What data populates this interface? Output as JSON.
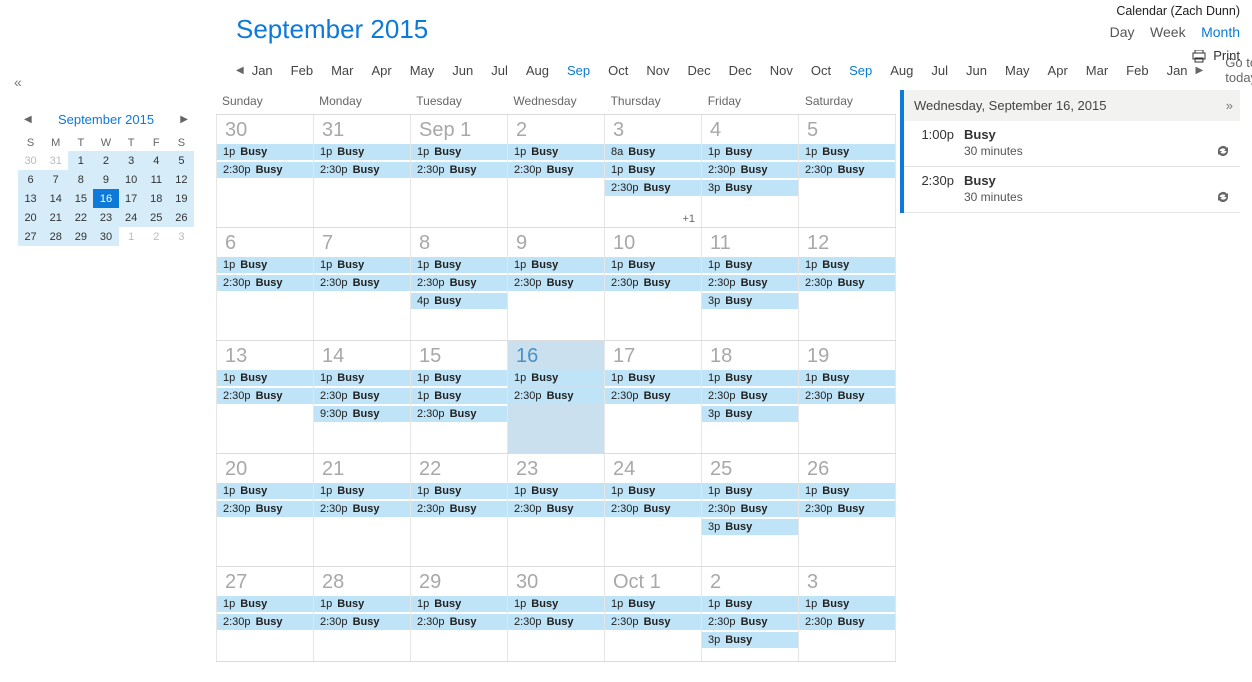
{
  "header": {
    "account_label": "Calendar (Zach Dunn)",
    "views": {
      "day": "Day",
      "week": "Week",
      "month": "Month",
      "active": "month"
    },
    "print_label": "Print"
  },
  "title": "September 2015",
  "month_strip": {
    "months": [
      "Jan",
      "Feb",
      "Mar",
      "Apr",
      "May",
      "Jun",
      "Jul",
      "Aug",
      "Sep",
      "Oct",
      "Nov",
      "Dec"
    ],
    "active_index": 8,
    "go_today": "Go to today"
  },
  "mini_cal": {
    "title": "September 2015",
    "dow": [
      "S",
      "M",
      "T",
      "W",
      "T",
      "F",
      "S"
    ],
    "rows": [
      [
        {
          "n": "30",
          "dim": true
        },
        {
          "n": "31",
          "dim": true
        },
        {
          "n": "1",
          "r": true
        },
        {
          "n": "2",
          "r": true
        },
        {
          "n": "3",
          "r": true
        },
        {
          "n": "4",
          "r": true
        },
        {
          "n": "5",
          "r": true
        }
      ],
      [
        {
          "n": "6",
          "r": true
        },
        {
          "n": "7",
          "r": true
        },
        {
          "n": "8",
          "r": true
        },
        {
          "n": "9",
          "r": true
        },
        {
          "n": "10",
          "r": true
        },
        {
          "n": "11",
          "r": true
        },
        {
          "n": "12",
          "r": true
        }
      ],
      [
        {
          "n": "13",
          "r": true
        },
        {
          "n": "14",
          "r": true
        },
        {
          "n": "15",
          "r": true
        },
        {
          "n": "16",
          "r": true,
          "sel": true
        },
        {
          "n": "17",
          "r": true
        },
        {
          "n": "18",
          "r": true
        },
        {
          "n": "19",
          "r": true
        }
      ],
      [
        {
          "n": "20",
          "r": true
        },
        {
          "n": "21",
          "r": true
        },
        {
          "n": "22",
          "r": true
        },
        {
          "n": "23",
          "r": true
        },
        {
          "n": "24",
          "r": true
        },
        {
          "n": "25",
          "r": true
        },
        {
          "n": "26",
          "r": true
        }
      ],
      [
        {
          "n": "27",
          "r": true
        },
        {
          "n": "28",
          "r": true
        },
        {
          "n": "29",
          "r": true
        },
        {
          "n": "30",
          "r": true
        },
        {
          "n": "1",
          "dim": true
        },
        {
          "n": "2",
          "dim": true
        },
        {
          "n": "3",
          "dim": true
        }
      ]
    ]
  },
  "grid": {
    "dow": [
      "Sunday",
      "Monday",
      "Tuesday",
      "Wednesday",
      "Thursday",
      "Friday",
      "Saturday"
    ],
    "weeks": [
      [
        {
          "label": "30",
          "events": [
            {
              "t": "1p",
              "s": "Busy"
            },
            {
              "t": "2:30p",
              "s": "Busy"
            }
          ]
        },
        {
          "label": "31",
          "events": [
            {
              "t": "1p",
              "s": "Busy"
            },
            {
              "t": "2:30p",
              "s": "Busy"
            }
          ]
        },
        {
          "label": "Sep 1",
          "events": [
            {
              "t": "1p",
              "s": "Busy"
            },
            {
              "t": "2:30p",
              "s": "Busy"
            }
          ]
        },
        {
          "label": "2",
          "events": [
            {
              "t": "1p",
              "s": "Busy"
            },
            {
              "t": "2:30p",
              "s": "Busy"
            }
          ]
        },
        {
          "label": "3",
          "events": [
            {
              "t": "8a",
              "s": "Busy"
            },
            {
              "t": "1p",
              "s": "Busy"
            },
            {
              "t": "2:30p",
              "s": "Busy"
            }
          ],
          "more": "+1"
        },
        {
          "label": "4",
          "events": [
            {
              "t": "1p",
              "s": "Busy"
            },
            {
              "t": "2:30p",
              "s": "Busy"
            },
            {
              "t": "3p",
              "s": "Busy"
            }
          ]
        },
        {
          "label": "5",
          "events": [
            {
              "t": "1p",
              "s": "Busy"
            },
            {
              "t": "2:30p",
              "s": "Busy"
            }
          ]
        }
      ],
      [
        {
          "label": "6",
          "events": [
            {
              "t": "1p",
              "s": "Busy"
            },
            {
              "t": "2:30p",
              "s": "Busy"
            }
          ]
        },
        {
          "label": "7",
          "events": [
            {
              "t": "1p",
              "s": "Busy"
            },
            {
              "t": "2:30p",
              "s": "Busy"
            }
          ]
        },
        {
          "label": "8",
          "events": [
            {
              "t": "1p",
              "s": "Busy"
            },
            {
              "t": "2:30p",
              "s": "Busy"
            },
            {
              "t": "4p",
              "s": "Busy"
            }
          ]
        },
        {
          "label": "9",
          "events": [
            {
              "t": "1p",
              "s": "Busy"
            },
            {
              "t": "2:30p",
              "s": "Busy"
            }
          ]
        },
        {
          "label": "10",
          "events": [
            {
              "t": "1p",
              "s": "Busy"
            },
            {
              "t": "2:30p",
              "s": "Busy"
            }
          ]
        },
        {
          "label": "11",
          "events": [
            {
              "t": "1p",
              "s": "Busy"
            },
            {
              "t": "2:30p",
              "s": "Busy"
            },
            {
              "t": "3p",
              "s": "Busy"
            }
          ]
        },
        {
          "label": "12",
          "events": [
            {
              "t": "1p",
              "s": "Busy"
            },
            {
              "t": "2:30p",
              "s": "Busy"
            }
          ]
        }
      ],
      [
        {
          "label": "13",
          "events": [
            {
              "t": "1p",
              "s": "Busy"
            },
            {
              "t": "2:30p",
              "s": "Busy"
            }
          ]
        },
        {
          "label": "14",
          "events": [
            {
              "t": "1p",
              "s": "Busy"
            },
            {
              "t": "2:30p",
              "s": "Busy"
            },
            {
              "t": "9:30p",
              "s": "Busy"
            }
          ]
        },
        {
          "label": "15",
          "events": [
            {
              "t": "1p",
              "s": "Busy"
            },
            {
              "t": "1p",
              "s": "Busy"
            },
            {
              "t": "2:30p",
              "s": "Busy"
            }
          ]
        },
        {
          "label": "16",
          "selected": true,
          "events": [
            {
              "t": "1p",
              "s": "Busy"
            },
            {
              "t": "2:30p",
              "s": "Busy"
            }
          ]
        },
        {
          "label": "17",
          "events": [
            {
              "t": "1p",
              "s": "Busy"
            },
            {
              "t": "2:30p",
              "s": "Busy"
            }
          ]
        },
        {
          "label": "18",
          "events": [
            {
              "t": "1p",
              "s": "Busy"
            },
            {
              "t": "2:30p",
              "s": "Busy"
            },
            {
              "t": "3p",
              "s": "Busy"
            }
          ]
        },
        {
          "label": "19",
          "events": [
            {
              "t": "1p",
              "s": "Busy"
            },
            {
              "t": "2:30p",
              "s": "Busy"
            }
          ]
        }
      ],
      [
        {
          "label": "20",
          "events": [
            {
              "t": "1p",
              "s": "Busy"
            },
            {
              "t": "2:30p",
              "s": "Busy"
            }
          ]
        },
        {
          "label": "21",
          "events": [
            {
              "t": "1p",
              "s": "Busy"
            },
            {
              "t": "2:30p",
              "s": "Busy"
            }
          ]
        },
        {
          "label": "22",
          "events": [
            {
              "t": "1p",
              "s": "Busy"
            },
            {
              "t": "2:30p",
              "s": "Busy"
            }
          ]
        },
        {
          "label": "23",
          "events": [
            {
              "t": "1p",
              "s": "Busy"
            },
            {
              "t": "2:30p",
              "s": "Busy"
            }
          ]
        },
        {
          "label": "24",
          "events": [
            {
              "t": "1p",
              "s": "Busy"
            },
            {
              "t": "2:30p",
              "s": "Busy"
            }
          ]
        },
        {
          "label": "25",
          "events": [
            {
              "t": "1p",
              "s": "Busy"
            },
            {
              "t": "2:30p",
              "s": "Busy"
            },
            {
              "t": "3p",
              "s": "Busy"
            }
          ]
        },
        {
          "label": "26",
          "events": [
            {
              "t": "1p",
              "s": "Busy"
            },
            {
              "t": "2:30p",
              "s": "Busy"
            }
          ]
        }
      ],
      [
        {
          "label": "27",
          "events": [
            {
              "t": "1p",
              "s": "Busy"
            },
            {
              "t": "2:30p",
              "s": "Busy"
            }
          ]
        },
        {
          "label": "28",
          "events": [
            {
              "t": "1p",
              "s": "Busy"
            },
            {
              "t": "2:30p",
              "s": "Busy"
            }
          ]
        },
        {
          "label": "29",
          "events": [
            {
              "t": "1p",
              "s": "Busy"
            },
            {
              "t": "2:30p",
              "s": "Busy"
            }
          ]
        },
        {
          "label": "30",
          "events": [
            {
              "t": "1p",
              "s": "Busy"
            },
            {
              "t": "2:30p",
              "s": "Busy"
            }
          ]
        },
        {
          "label": "Oct 1",
          "events": [
            {
              "t": "1p",
              "s": "Busy"
            },
            {
              "t": "2:30p",
              "s": "Busy"
            }
          ]
        },
        {
          "label": "2",
          "events": [
            {
              "t": "1p",
              "s": "Busy"
            },
            {
              "t": "2:30p",
              "s": "Busy"
            },
            {
              "t": "3p",
              "s": "Busy"
            }
          ]
        },
        {
          "label": "3",
          "events": [
            {
              "t": "1p",
              "s": "Busy"
            },
            {
              "t": "2:30p",
              "s": "Busy"
            }
          ]
        }
      ]
    ]
  },
  "detail": {
    "title": "Wednesday, September 16, 2015",
    "items": [
      {
        "time": "1:00p",
        "subject": "Busy",
        "duration": "30 minutes"
      },
      {
        "time": "2:30p",
        "subject": "Busy",
        "duration": "30 minutes"
      }
    ]
  }
}
